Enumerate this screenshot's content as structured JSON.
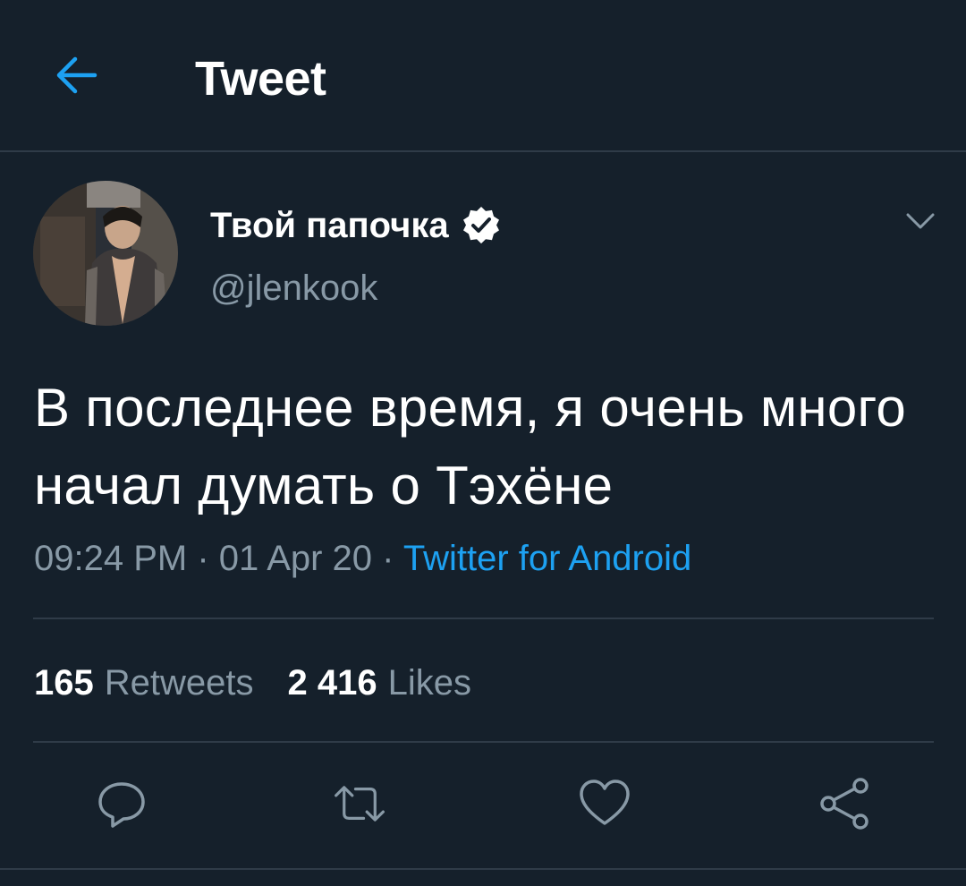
{
  "header": {
    "title": "Tweet",
    "back_icon": "arrow-left-icon"
  },
  "colors": {
    "background": "#15202b",
    "accent": "#1da1f2",
    "secondary_text": "#8899a6",
    "divider": "#2f3b48"
  },
  "tweet": {
    "author": {
      "display_name": "Твой папочка",
      "handle": "@jlenkook",
      "verified": true
    },
    "text": "В последнее время, я очень много начал думать о Тэхёне",
    "time": "09:24 PM",
    "separator": "·",
    "date": "01 Apr 20",
    "source": "Twitter for Android",
    "stats": {
      "retweets_count": "165",
      "retweets_label": "Retweets",
      "likes_count": "2 416",
      "likes_label": "Likes"
    },
    "actions": [
      "reply-icon",
      "retweet-icon",
      "like-icon",
      "share-icon"
    ]
  }
}
